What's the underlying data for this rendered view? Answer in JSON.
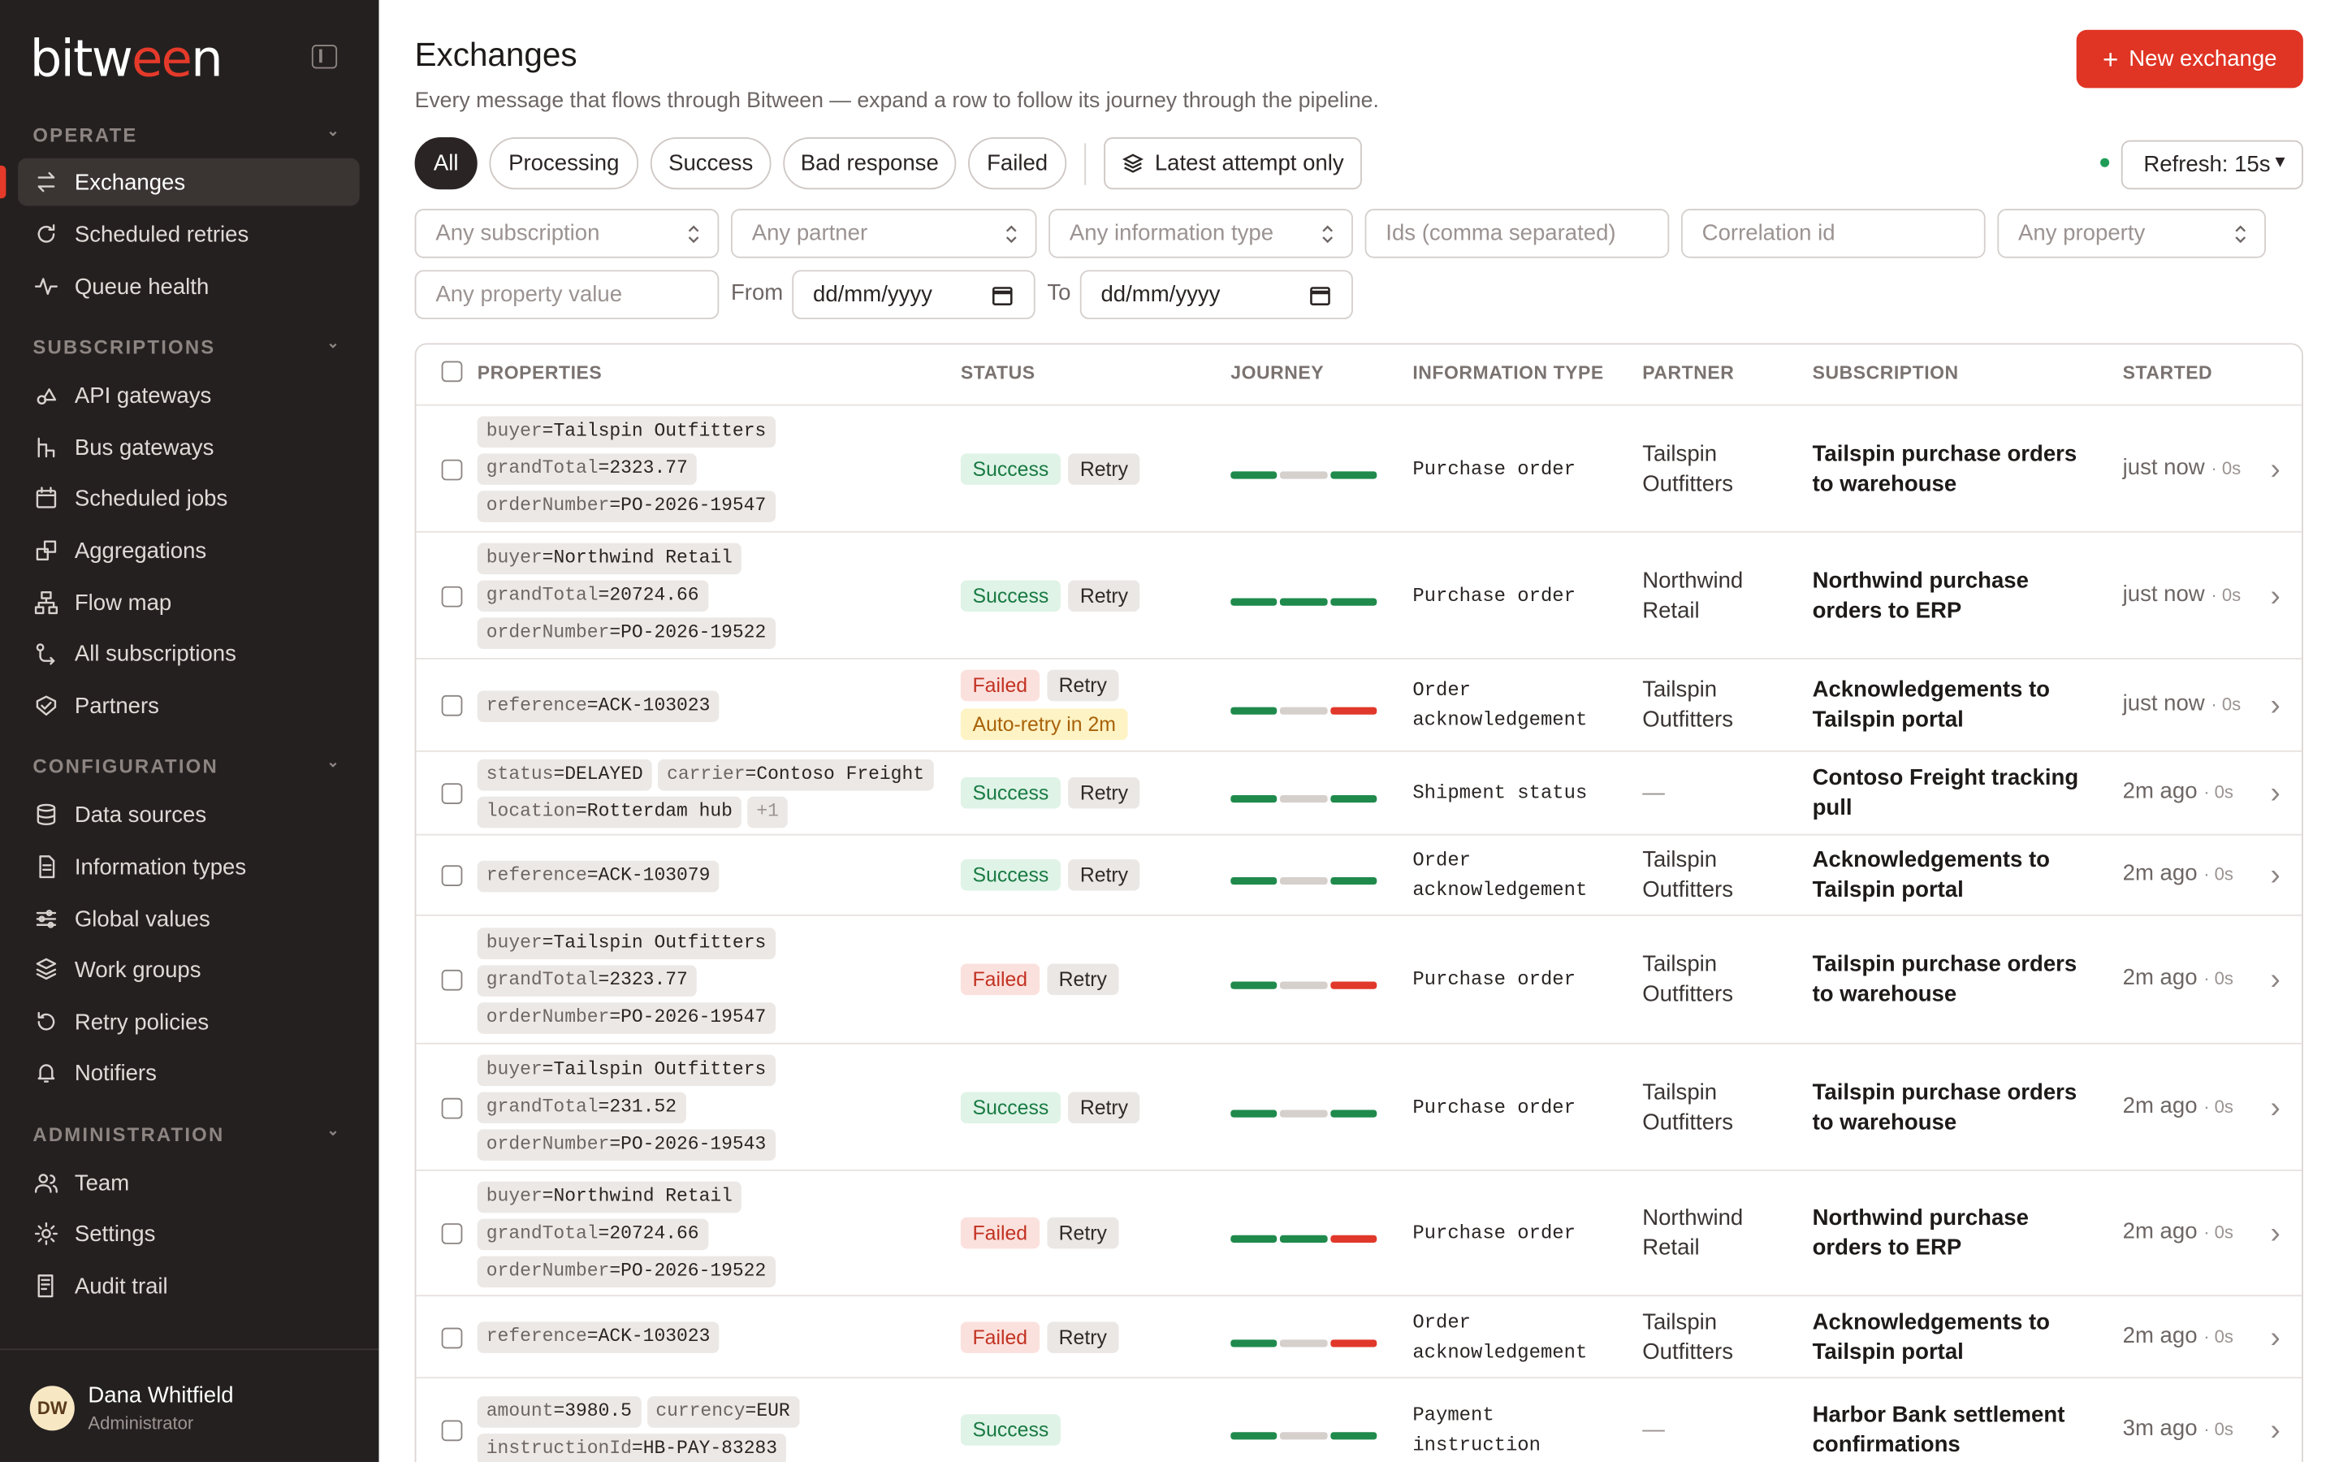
{
  "brand": {
    "logo_prefix": "bitw",
    "logo_accent": "ee",
    "logo_suffix": "n",
    "accent": "#e53a2a"
  },
  "sidebar": {
    "sections": [
      {
        "label": "OPERATE",
        "items": [
          "Exchanges",
          "Scheduled retries",
          "Queue health"
        ]
      },
      {
        "label": "SUBSCRIPTIONS",
        "items": [
          "API gateways",
          "Bus gateways",
          "Scheduled jobs",
          "Aggregations",
          "Flow map",
          "All subscriptions",
          "Partners"
        ]
      },
      {
        "label": "CONFIGURATION",
        "items": [
          "Data sources",
          "Information types",
          "Global values",
          "Work groups",
          "Retry policies",
          "Notifiers"
        ]
      },
      {
        "label": "ADMINISTRATION",
        "items": [
          "Team",
          "Settings",
          "Audit trail"
        ]
      }
    ],
    "active_item": "Exchanges",
    "user": {
      "initials": "DW",
      "name": "Dana Whitfield",
      "role": "Administrator"
    }
  },
  "header": {
    "title": "Exchanges",
    "subtitle": "Every message that flows through Bitween — expand a row to follow its journey through the pipeline.",
    "new_button": "New exchange"
  },
  "filters": {
    "chips": [
      "All",
      "Processing",
      "Success",
      "Bad response",
      "Failed"
    ],
    "selected_chip": "All",
    "latest_toggle": "Latest attempt only",
    "refresh": "Refresh: 15s",
    "subscription": "Any subscription",
    "partner": "Any partner",
    "information_type": "Any information type",
    "ids_placeholder": "Ids (comma separated)",
    "correlation_placeholder": "Correlation id",
    "property": "Any property",
    "property_value_placeholder": "Any property value",
    "from_label": "From",
    "to_label": "To",
    "date_placeholder": "dd/mm/yyyy"
  },
  "table": {
    "columns": [
      "PROPERTIES",
      "STATUS",
      "JOURNEY",
      "INFORMATION TYPE",
      "PARTNER",
      "SUBSCRIPTION",
      "STARTED"
    ],
    "status_colors": {
      "success": "#1f8a4c",
      "failed": "#e0382a",
      "pending": "#d6d0cd"
    },
    "rows": [
      {
        "props": [
          [
            "buyer",
            "Tailspin Outfitters"
          ],
          [
            "grandTotal",
            "2323.77"
          ],
          [
            "orderNumber",
            "PO-2026-19547"
          ]
        ],
        "status": "Success",
        "retry": "Retry",
        "journey": [
          "success",
          "pending",
          "success"
        ],
        "info_type": "Purchase order",
        "partner": "Tailspin Outfitters",
        "subscription": "Tailspin purchase orders to warehouse",
        "started": "just now",
        "duration": "· 0s"
      },
      {
        "props": [
          [
            "buyer",
            "Northwind Retail"
          ],
          [
            "grandTotal",
            "20724.66"
          ],
          [
            "orderNumber",
            "PO-2026-19522"
          ]
        ],
        "status": "Success",
        "retry": "Retry",
        "journey": [
          "success",
          "success",
          "success"
        ],
        "info_type": "Purchase order",
        "partner": "Northwind Retail",
        "subscription": "Northwind purchase orders to ERP",
        "started": "just now",
        "duration": "· 0s"
      },
      {
        "props": [
          [
            "reference",
            "ACK-103023"
          ]
        ],
        "status": "Failed",
        "retry": "Retry",
        "auto": "Auto-retry in 2m",
        "journey": [
          "success",
          "pending",
          "failed"
        ],
        "info_type": "Order acknowledgement",
        "partner": "Tailspin Outfitters",
        "subscription": "Acknowledgements to Tailspin portal",
        "started": "just now",
        "duration": "· 0s"
      },
      {
        "props": [
          [
            "status",
            "DELAYED"
          ],
          [
            "carrier",
            "Contoso Freight"
          ],
          [
            "location",
            "Rotterdam hub"
          ]
        ],
        "more": "+1",
        "status": "Success",
        "retry": "Retry",
        "journey": [
          "success",
          "pending",
          "success"
        ],
        "info_type": "Shipment status",
        "partner": "—",
        "subscription": "Contoso Freight tracking pull",
        "started": "2m ago",
        "duration": "· 0s"
      },
      {
        "props": [
          [
            "reference",
            "ACK-103079"
          ]
        ],
        "status": "Success",
        "retry": "Retry",
        "journey": [
          "success",
          "pending",
          "success"
        ],
        "info_type": "Order acknowledgement",
        "partner": "Tailspin Outfitters",
        "subscription": "Acknowledgements to Tailspin portal",
        "started": "2m ago",
        "duration": "· 0s"
      },
      {
        "props": [
          [
            "buyer",
            "Tailspin Outfitters"
          ],
          [
            "grandTotal",
            "2323.77"
          ],
          [
            "orderNumber",
            "PO-2026-19547"
          ]
        ],
        "status": "Failed",
        "retry": "Retry",
        "journey": [
          "success",
          "pending",
          "failed"
        ],
        "info_type": "Purchase order",
        "partner": "Tailspin Outfitters",
        "subscription": "Tailspin purchase orders to warehouse",
        "started": "2m ago",
        "duration": "· 0s"
      },
      {
        "props": [
          [
            "buyer",
            "Tailspin Outfitters"
          ],
          [
            "grandTotal",
            "231.52"
          ],
          [
            "orderNumber",
            "PO-2026-19543"
          ]
        ],
        "status": "Success",
        "retry": "Retry",
        "journey": [
          "success",
          "pending",
          "success"
        ],
        "info_type": "Purchase order",
        "partner": "Tailspin Outfitters",
        "subscription": "Tailspin purchase orders to warehouse",
        "started": "2m ago",
        "duration": "· 0s"
      },
      {
        "props": [
          [
            "buyer",
            "Northwind Retail"
          ],
          [
            "grandTotal",
            "20724.66"
          ],
          [
            "orderNumber",
            "PO-2026-19522"
          ]
        ],
        "status": "Failed",
        "retry": "Retry",
        "journey": [
          "success",
          "success",
          "failed"
        ],
        "info_type": "Purchase order",
        "partner": "Northwind Retail",
        "subscription": "Northwind purchase orders to ERP",
        "started": "2m ago",
        "duration": "· 0s"
      },
      {
        "props": [
          [
            "reference",
            "ACK-103023"
          ]
        ],
        "status": "Failed",
        "retry": "Retry",
        "journey": [
          "success",
          "pending",
          "failed"
        ],
        "info_type": "Order acknowledgement",
        "partner": "Tailspin Outfitters",
        "subscription": "Acknowledgements to Tailspin portal",
        "started": "2m ago",
        "duration": "· 0s"
      },
      {
        "props": [
          [
            "amount",
            "3980.5"
          ],
          [
            "currency",
            "EUR"
          ],
          [
            "instructionId",
            "HB-PAY-83283"
          ]
        ],
        "status": "Success",
        "journey": [
          "success",
          "pending",
          "success"
        ],
        "info_type": "Payment instruction",
        "partner": "—",
        "subscription": "Harbor Bank settlement confirmations",
        "started": "3m ago",
        "duration": "· 0s"
      }
    ]
  }
}
